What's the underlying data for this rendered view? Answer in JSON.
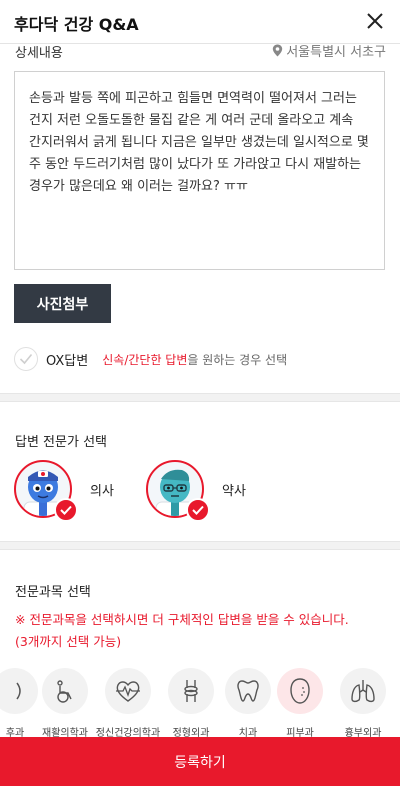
{
  "header": {
    "title": "후다닥 건강 Q&A"
  },
  "detail": {
    "label": "상세내용",
    "location": "서울특별시 서초구",
    "content": "손등과 발등 쪽에 피곤하고 힘들면 면역력이 떨어져서 그러는 건지 저런 오돌도돌한 물집 같은 게 여러 군데 올라오고 계속 간지러워서 긁게 됩니다 지금은 일부만 생겼는데 일시적으로 몇 주 동안 두드러기처럼 많이 났다가 또 가라앉고 다시 재발하는 경우가 많은데요 왜 이러는 걸까요? ㅠㅠ"
  },
  "photo_button": "사진첨부",
  "ox": {
    "label": "OX답변",
    "highlight": "신속/간단한 답변",
    "desc": "을 원하는 경우 선택"
  },
  "expert_section": {
    "title": "답변 전문가 선택",
    "experts": [
      {
        "label": "의사"
      },
      {
        "label": "약사"
      }
    ]
  },
  "dept_section": {
    "title": "전문과목 선택",
    "notice_line1": "※ 전문과목을 선택하시면 더 구체적인 답변을 받을 수 있습니다.",
    "notice_line2": "(3개까지 선택 가능)",
    "departments": [
      {
        "name": "후과",
        "icon": "partial-icon"
      },
      {
        "name": "재활의학과",
        "icon": "wheelchair-icon"
      },
      {
        "name": "정신건강의학과",
        "icon": "heartbeat-icon"
      },
      {
        "name": "정형외과",
        "icon": "joint-icon"
      },
      {
        "name": "치과",
        "icon": "tooth-icon"
      },
      {
        "name": "피부과",
        "icon": "face-icon",
        "selected": true
      },
      {
        "name": "흉부외과",
        "icon": "lungs-icon"
      }
    ]
  },
  "submit_button": "등록하기",
  "colors": {
    "accent": "#e8192c",
    "dark_button": "#333a44"
  }
}
